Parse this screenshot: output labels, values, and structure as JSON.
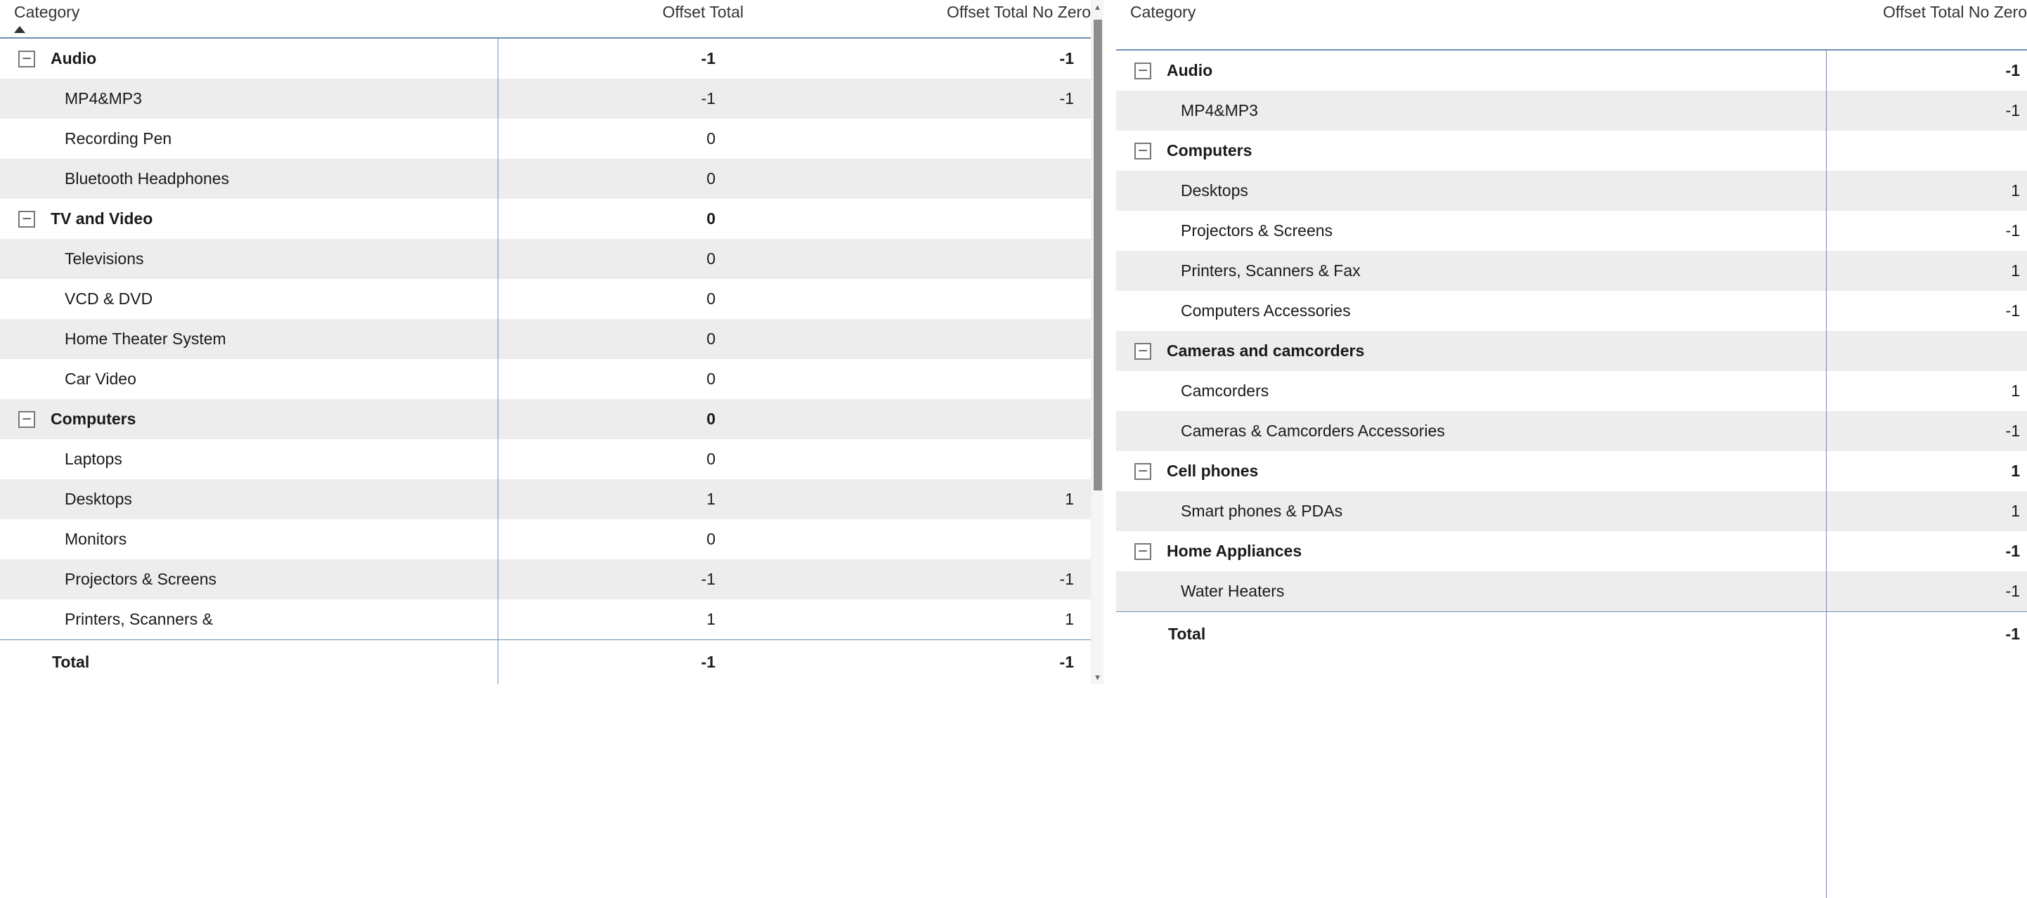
{
  "left": {
    "headers": {
      "category": "Category",
      "v1": "Offset Total",
      "v2": "Offset Total No Zero"
    },
    "rows": [
      {
        "kind": "group",
        "stripe": false,
        "label": "Audio",
        "v1": "-1",
        "v2": "-1"
      },
      {
        "kind": "child",
        "stripe": true,
        "label": "MP4&MP3",
        "v1": "-1",
        "v2": "-1"
      },
      {
        "kind": "child",
        "stripe": false,
        "label": "Recording Pen",
        "v1": "0",
        "v2": ""
      },
      {
        "kind": "child",
        "stripe": true,
        "label": "Bluetooth Headphones",
        "v1": "0",
        "v2": ""
      },
      {
        "kind": "group",
        "stripe": false,
        "label": "TV and Video",
        "v1": "0",
        "v2": ""
      },
      {
        "kind": "child",
        "stripe": true,
        "label": "Televisions",
        "v1": "0",
        "v2": ""
      },
      {
        "kind": "child",
        "stripe": false,
        "label": "VCD & DVD",
        "v1": "0",
        "v2": ""
      },
      {
        "kind": "child",
        "stripe": true,
        "label": "Home Theater System",
        "v1": "0",
        "v2": ""
      },
      {
        "kind": "child",
        "stripe": false,
        "label": "Car Video",
        "v1": "0",
        "v2": ""
      },
      {
        "kind": "group",
        "stripe": true,
        "label": "Computers",
        "v1": "0",
        "v2": ""
      },
      {
        "kind": "child",
        "stripe": false,
        "label": "Laptops",
        "v1": "0",
        "v2": ""
      },
      {
        "kind": "child",
        "stripe": true,
        "label": "Desktops",
        "v1": "1",
        "v2": "1"
      },
      {
        "kind": "child",
        "stripe": false,
        "label": "Monitors",
        "v1": "0",
        "v2": ""
      },
      {
        "kind": "child",
        "stripe": true,
        "label": "Projectors & Screens",
        "v1": "-1",
        "v2": "-1"
      },
      {
        "kind": "child",
        "stripe": false,
        "label": "Printers, Scanners &",
        "v1": "1",
        "v2": "1"
      }
    ],
    "total": {
      "label": "Total",
      "v1": "-1",
      "v2": "-1"
    }
  },
  "right": {
    "headers": {
      "category": "Category",
      "v2": "Offset Total No Zero"
    },
    "rows": [
      {
        "kind": "group",
        "stripe": false,
        "label": "Audio",
        "v2": "-1"
      },
      {
        "kind": "child",
        "stripe": true,
        "label": "MP4&MP3",
        "v2": "-1"
      },
      {
        "kind": "group",
        "stripe": false,
        "label": "Computers",
        "v2": ""
      },
      {
        "kind": "child",
        "stripe": true,
        "label": "Desktops",
        "v2": "1"
      },
      {
        "kind": "child",
        "stripe": false,
        "label": "Projectors & Screens",
        "v2": "-1"
      },
      {
        "kind": "child",
        "stripe": true,
        "label": "Printers, Scanners & Fax",
        "v2": "1"
      },
      {
        "kind": "child",
        "stripe": false,
        "label": "Computers Accessories",
        "v2": "-1"
      },
      {
        "kind": "group",
        "stripe": true,
        "label": "Cameras and camcorders",
        "v2": ""
      },
      {
        "kind": "child",
        "stripe": false,
        "label": "Camcorders",
        "v2": "1"
      },
      {
        "kind": "child",
        "stripe": true,
        "label": "Cameras & Camcorders Accessories",
        "v2": "-1"
      },
      {
        "kind": "group",
        "stripe": false,
        "label": "Cell phones",
        "v2": "1"
      },
      {
        "kind": "child",
        "stripe": true,
        "label": "Smart phones & PDAs",
        "v2": "1"
      },
      {
        "kind": "group",
        "stripe": false,
        "label": "Home Appliances",
        "v2": "-1"
      },
      {
        "kind": "child",
        "stripe": true,
        "label": "Water Heaters",
        "v2": "-1"
      }
    ],
    "total": {
      "label": "Total",
      "v2": "-1"
    }
  }
}
